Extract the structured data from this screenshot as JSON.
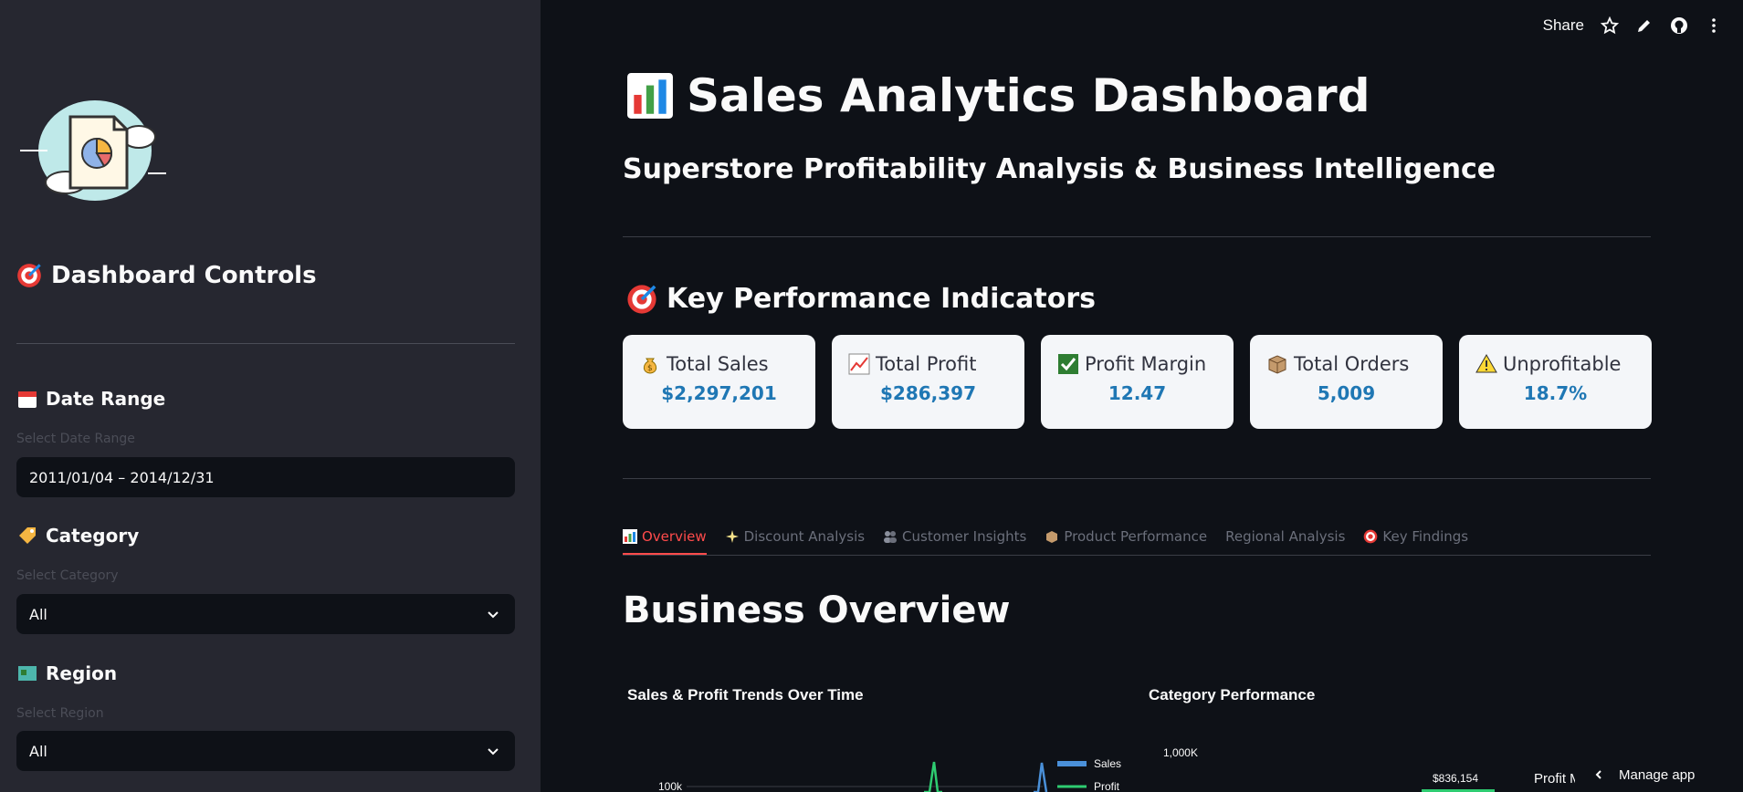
{
  "header": {
    "share_label": "Share",
    "icons": [
      "star-icon",
      "pencil-icon",
      "github-icon",
      "more-icon"
    ]
  },
  "sidebar": {
    "logo_icon": "report-cloud-logo",
    "title": "Dashboard Controls",
    "title_icon": "target-icon",
    "date_range": {
      "heading": "Date Range",
      "icon": "calendar-icon",
      "label": "Select Date Range",
      "value": "2011/01/04 – 2014/12/31"
    },
    "category": {
      "heading": "Category",
      "icon": "tag-icon",
      "label": "Select Category",
      "value": "All"
    },
    "region": {
      "heading": "Region",
      "icon": "map-icon",
      "label": "Select Region",
      "value": "All"
    }
  },
  "main": {
    "title": "Sales Analytics Dashboard",
    "title_icon": "bar-chart-icon",
    "subtitle": "Superstore Profitability Analysis & Business Intelligence",
    "kpi_heading": "Key Performance Indicators",
    "kpis": [
      {
        "label": "Total Sales",
        "value": "$2,297,201",
        "icon": "money-bag-icon"
      },
      {
        "label": "Total Profit",
        "value": "$286,397",
        "icon": "trend-up-icon"
      },
      {
        "label": "Profit Margin",
        "value": "12.47",
        "icon": "check-icon"
      },
      {
        "label": "Total Orders",
        "value": "5,009",
        "icon": "box-icon"
      },
      {
        "label": "Unprofitable",
        "value": "18.7%",
        "icon": "warning-icon"
      }
    ],
    "tabs": [
      {
        "label": "Overview",
        "icon": "bar-chart-icon",
        "active": true
      },
      {
        "label": "Discount Analysis",
        "icon": "sparkle-icon"
      },
      {
        "label": "Customer Insights",
        "icon": "people-icon"
      },
      {
        "label": "Product Performance",
        "icon": "box-icon"
      },
      {
        "label": "Regional Analysis",
        "icon": ""
      },
      {
        "label": "Key Findings",
        "icon": "target-icon"
      }
    ],
    "section_title": "Business Overview",
    "manage_app": "Manage app"
  },
  "chart_data": [
    {
      "type": "line",
      "title": "Sales & Profit Trends Over Time",
      "y_tick_labels": [
        "100k"
      ],
      "series": [
        {
          "name": "Sales"
        },
        {
          "name": "Profit"
        }
      ],
      "legend": "right"
    },
    {
      "type": "bar",
      "title": "Category Performance",
      "y_tick_labels": [
        "1,000K"
      ],
      "data_labels": [
        "$836,154"
      ],
      "values": [
        836154
      ],
      "legend_partial": "Profit Marg"
    }
  ],
  "colors": {
    "accent": "#ff4b4b",
    "kpi_value": "#1f77b4",
    "sales": "#4a90d9",
    "profit": "#2ecc71"
  }
}
